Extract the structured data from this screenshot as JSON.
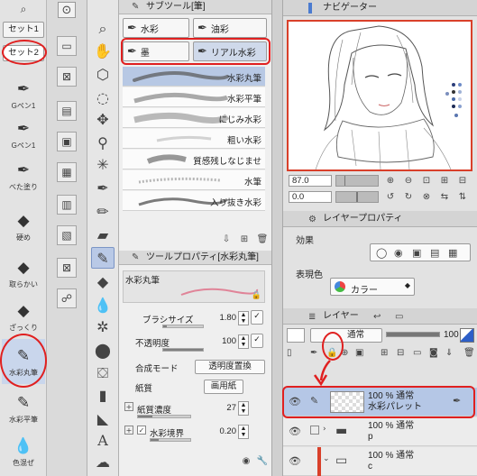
{
  "custom_brush_panel": {
    "set1_label": "セット1",
    "set2_label": "セット2",
    "presets": [
      {
        "label": "Gペン1",
        "icon": "pen-icon"
      },
      {
        "label": "Gペン1",
        "icon": "pen-icon"
      },
      {
        "label": "べた塗り",
        "icon": "fill-pen-icon"
      },
      {
        "label": "硬め",
        "icon": "eraser-icon"
      },
      {
        "label": "取らかい",
        "icon": "eraser-icon"
      },
      {
        "label": "ざっくり",
        "icon": "eraser-icon"
      },
      {
        "label": "水彩丸筆",
        "icon": "watercolor-brush-icon"
      },
      {
        "label": "水彩平筆",
        "icon": "watercolor-brush-icon"
      },
      {
        "label": "色混ぜ",
        "icon": "blend-icon"
      }
    ]
  },
  "sub_tool": {
    "header": "サブツール[筆]",
    "tabs": [
      "水彩",
      "油彩",
      "墨",
      "リアル水彩"
    ],
    "brushes": [
      "水彩丸筆",
      "水彩平筆",
      "にじみ水彩",
      "粗い水彩",
      "質感残しなじませ",
      "水筆",
      "入り抜き水彩"
    ]
  },
  "tool_property": {
    "header": "ツールプロパティ[水彩丸筆]",
    "preview_label": "水彩丸筆",
    "brush_size_label": "ブラシサイズ",
    "brush_size_value": "1.80",
    "opacity_label": "不透明度",
    "opacity_value": "100",
    "blend_mode_label": "合成モード",
    "blend_mode_value": "透明度置換",
    "paper_label": "紙質",
    "paper_value": "画用紙",
    "paper_density_label": "紙質濃度",
    "paper_density_value": "27",
    "watercolor_edge_label": "水彩境界",
    "watercolor_edge_value": "0.20"
  },
  "navigator": {
    "header": "ナビゲーター",
    "zoom_value": "87.0",
    "rotate_value": "0.0"
  },
  "layer_property": {
    "header": "レイヤープロパティ",
    "effect_label": "効果",
    "expression_color_label": "表現色",
    "color_value": "カラー"
  },
  "layer_panel": {
    "header": "レイヤー",
    "blend_mode": "通常",
    "opacity": "100",
    "layers": [
      {
        "line1": "100 % 通常",
        "line2": "水彩パレット"
      },
      {
        "line1": "100 % 通常",
        "line2": "p"
      },
      {
        "line1": "100 % 通常",
        "line2": "c"
      }
    ]
  },
  "colors": {
    "annotation_red": "#e02020",
    "selection_blue": "#b5c7e6",
    "navigator_red": "#d9402a"
  }
}
